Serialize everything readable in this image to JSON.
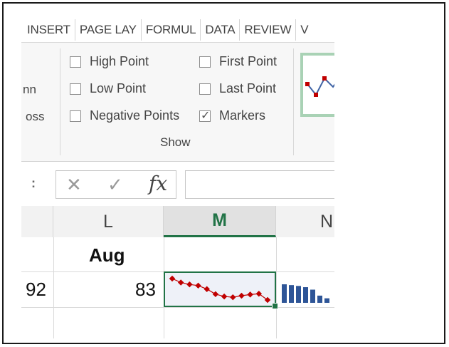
{
  "ribbon": {
    "tabs": [
      "INSERT",
      "PAGE LAY",
      "FORMUL",
      "DATA",
      "REVIEW",
      "V"
    ],
    "left_cut_labels": [
      "nn",
      "oss"
    ],
    "show_group": {
      "label": "Show",
      "checkboxes": [
        {
          "label": "High Point",
          "checked": false
        },
        {
          "label": "First Point",
          "checked": false
        },
        {
          "label": "Low Point",
          "checked": false
        },
        {
          "label": "Last Point",
          "checked": false
        },
        {
          "label": "Negative Points",
          "checked": false
        },
        {
          "label": "Markers",
          "checked": true
        }
      ]
    },
    "style_colors": {
      "border": "#a9d2b5",
      "line": "#3f63a5",
      "marker": "#c00000"
    }
  },
  "formula_bar": {
    "more_glyph": ":",
    "cancel_glyph": "✕",
    "enter_glyph": "✓",
    "fx_label": "fx",
    "value": ""
  },
  "columns": {
    "left_partial": "",
    "L": "L",
    "M": "M",
    "N": "N"
  },
  "cells": {
    "header_row": {
      "L": "Aug"
    },
    "data_row": {
      "K_partial": "92",
      "L": "83"
    }
  },
  "sparklines": {
    "line_color": "#c00000",
    "line_values": [
      9,
      8,
      7.5,
      7.2,
      6.3,
      5,
      4.4,
      4.2,
      4.6,
      4.9,
      5.1,
      3.5
    ],
    "column_color": "#2e5597",
    "column_values": [
      9,
      8.6,
      8.2,
      7.6,
      6.4,
      3.5,
      2.2
    ]
  }
}
